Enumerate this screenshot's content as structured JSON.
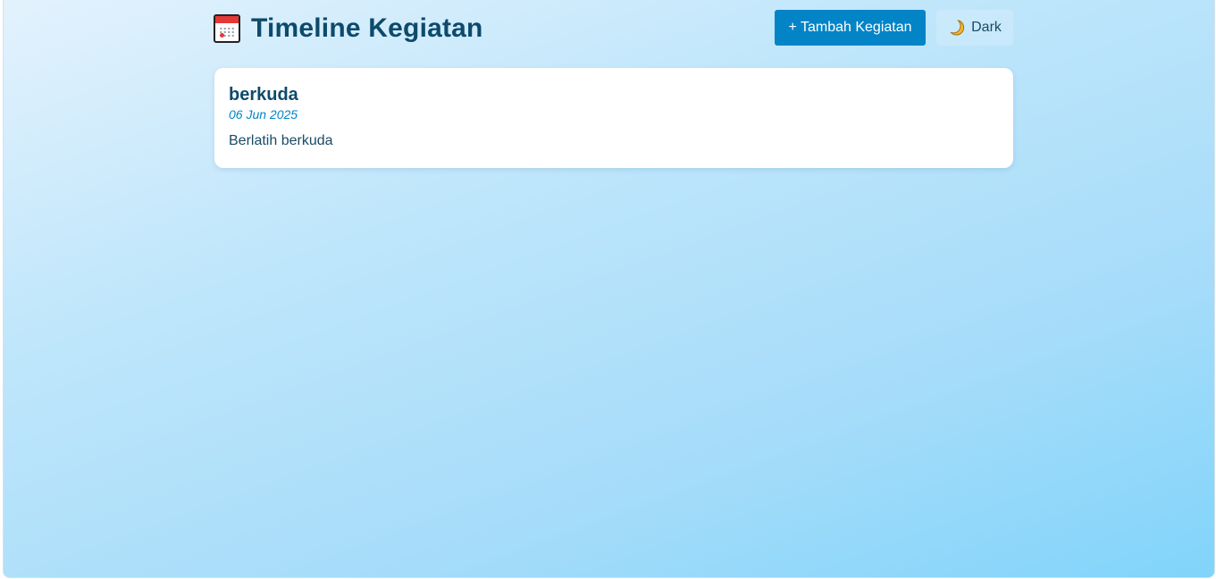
{
  "header": {
    "title": "Timeline Kegiatan",
    "icon": "calendar-icon",
    "add_button_label": "+ Tambah Kegiatan",
    "theme_toggle": {
      "icon": "moon-icon",
      "label": "Dark"
    }
  },
  "activities": [
    {
      "title": "berkuda",
      "date": "06 Jun 2025",
      "description": "Berlatih berkuda"
    }
  ],
  "colors": {
    "accent": "#0284c7",
    "title_text": "#0d4a6b",
    "background_start": "#e3f2fd",
    "background_end": "#81d4fa",
    "card_background": "#ffffff"
  }
}
